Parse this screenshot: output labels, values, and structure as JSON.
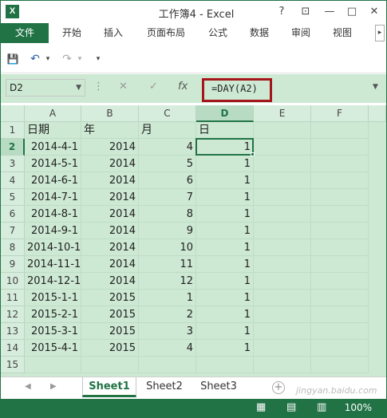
{
  "window": {
    "app_icon": "X",
    "title": "工作簿4 - Excel",
    "buttons": {
      "help": "?",
      "restore_ribbon": "⊡",
      "minimize": "—",
      "maximize": "□",
      "close": "✕"
    }
  },
  "ribbon": {
    "tabs": [
      "文件",
      "开始",
      "插入",
      "页面布局",
      "公式",
      "数据",
      "审阅",
      "视图"
    ],
    "active_tab": "文件",
    "scroll": "▸"
  },
  "quick_access": {
    "save": "💾",
    "undo": "↶",
    "redo": "↷",
    "customize": "▾"
  },
  "formula_bar": {
    "name_box": "D2",
    "cancel": "✕",
    "enter": "✓",
    "fx": "fx",
    "formula": "=DAY(A2)"
  },
  "grid": {
    "columns": [
      "A",
      "B",
      "C",
      "D",
      "E",
      "F"
    ],
    "selected_column": "D",
    "selected_row": "2",
    "rows": [
      {
        "n": "1",
        "A": "日期",
        "B": "年",
        "C": "月",
        "D": "日"
      },
      {
        "n": "2",
        "A": "2014-4-1",
        "B": "2014",
        "C": "4",
        "D": "1"
      },
      {
        "n": "3",
        "A": "2014-5-1",
        "B": "2014",
        "C": "5",
        "D": "1"
      },
      {
        "n": "4",
        "A": "2014-6-1",
        "B": "2014",
        "C": "6",
        "D": "1"
      },
      {
        "n": "5",
        "A": "2014-7-1",
        "B": "2014",
        "C": "7",
        "D": "1"
      },
      {
        "n": "6",
        "A": "2014-8-1",
        "B": "2014",
        "C": "8",
        "D": "1"
      },
      {
        "n": "7",
        "A": "2014-9-1",
        "B": "2014",
        "C": "9",
        "D": "1"
      },
      {
        "n": "8",
        "A": "2014-10-1",
        "B": "2014",
        "C": "10",
        "D": "1"
      },
      {
        "n": "9",
        "A": "2014-11-1",
        "B": "2014",
        "C": "11",
        "D": "1"
      },
      {
        "n": "10",
        "A": "2014-12-1",
        "B": "2014",
        "C": "12",
        "D": "1"
      },
      {
        "n": "11",
        "A": "2015-1-1",
        "B": "2015",
        "C": "1",
        "D": "1"
      },
      {
        "n": "12",
        "A": "2015-2-1",
        "B": "2015",
        "C": "2",
        "D": "1"
      },
      {
        "n": "13",
        "A": "2015-3-1",
        "B": "2015",
        "C": "3",
        "D": "1"
      },
      {
        "n": "14",
        "A": "2015-4-1",
        "B": "2015",
        "C": "4",
        "D": "1"
      },
      {
        "n": "15",
        "A": "",
        "B": "",
        "C": "",
        "D": ""
      }
    ]
  },
  "sheets": {
    "tabs": [
      "Sheet1",
      "Sheet2",
      "Sheet3"
    ],
    "active": "Sheet1",
    "nav_prev": "◀",
    "nav_next": "▶",
    "add": "+"
  },
  "status": {
    "normal_view": "▦",
    "page_layout": "▤",
    "page_break": "▥",
    "zoom": "100%"
  },
  "watermark": "jingyan.baidu.com",
  "colors": {
    "accent": "#217346",
    "grid_bg": "#cde9d3",
    "highlight": "#a4161b"
  }
}
